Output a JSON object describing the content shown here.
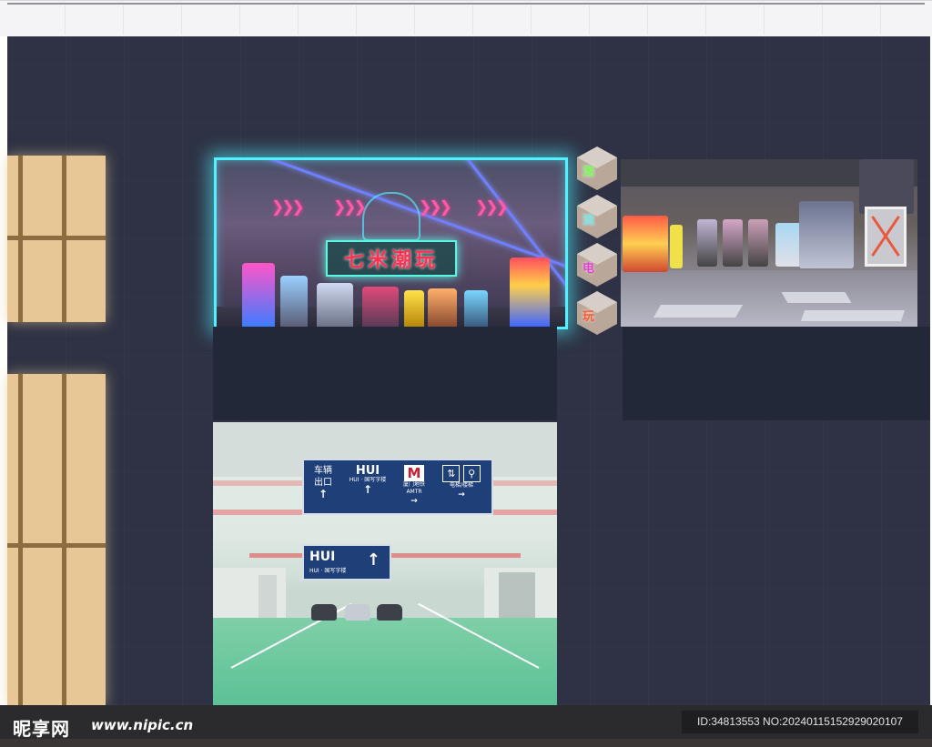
{
  "arcade_sign": {
    "name": "七米潮玩",
    "chevrons": [
      "❯❯❯",
      "❯❯❯",
      "❯❯❯",
      "❯❯❯"
    ]
  },
  "side_diamonds": [
    {
      "char": "潮",
      "color": "#7df25a"
    },
    {
      "char": "流",
      "color": "#6fe3e6"
    },
    {
      "char": "电",
      "color": "#e83ed4"
    },
    {
      "char": "玩",
      "color": "#ff5a2c"
    }
  ],
  "garage_sign": {
    "exit_line1": "车辆",
    "exit_line2": "出口",
    "exit_arrow": "↑",
    "hui_title": "HUI",
    "hui_sub": "HUI · 国写字楼",
    "hui_arrow": "↑",
    "metro_symbol": "M",
    "metro_label": "厦门地铁",
    "metro_sub": "AMTR",
    "metro_arrow": "→",
    "lift_label": "电梯/楼梯",
    "lift_arrow": "→"
  },
  "garage_sign_small": {
    "title": "HUI",
    "sub": "HUI · 国写字楼",
    "arrow": "↑"
  },
  "watermark": {
    "logo": "昵享网",
    "url": "www.nipic.cn",
    "id": "ID:34813553 NO:20240115152929020107"
  },
  "colors": {
    "stage_bg": "#2e3244",
    "neon_frame": "#52f1ff",
    "window_wood": "#e7c795",
    "sign_blue": "#1f3f78"
  }
}
